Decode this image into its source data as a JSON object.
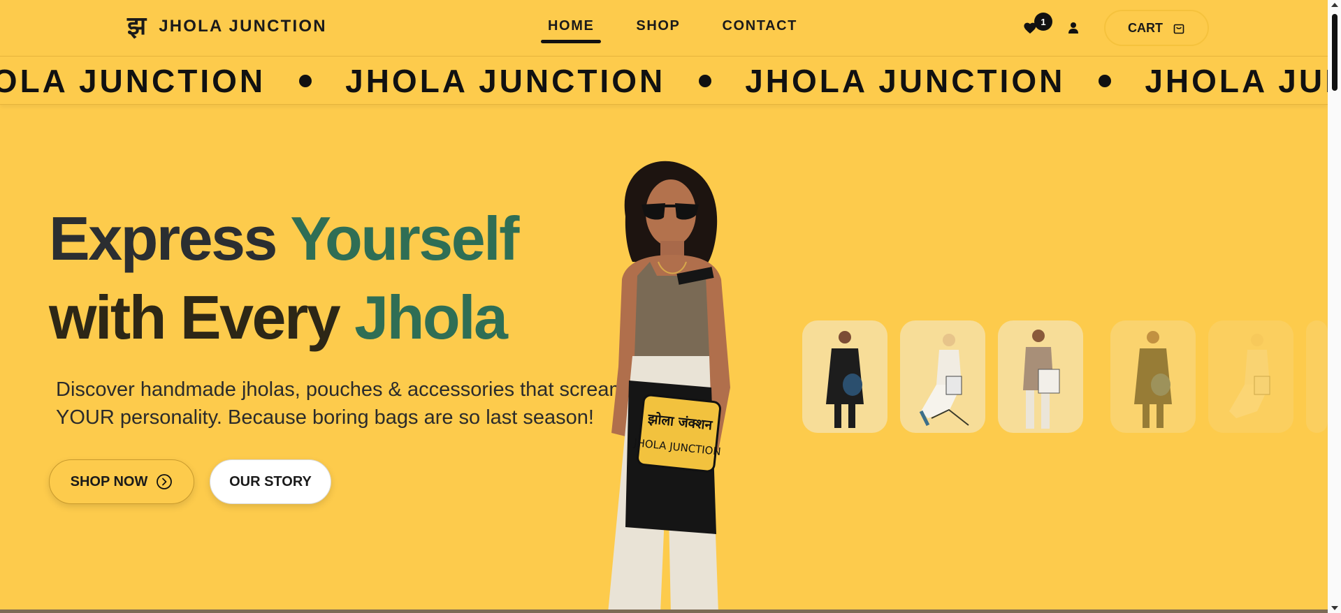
{
  "brand": {
    "logo_glyph": "झ",
    "name": "JHOLA JUNCTION"
  },
  "nav": {
    "home": "HOME",
    "shop": "SHOP",
    "contact": "CONTACT",
    "active": "HOME"
  },
  "header_actions": {
    "wishlist_icon": "heart-icon",
    "wishlist_count": "1",
    "account_icon": "user-icon",
    "cart_label": "CART",
    "cart_icon": "bag-icon"
  },
  "marquee": {
    "items": [
      "JHOLA JUNCTION",
      "JHOLA JUNCTION",
      "JHOLA JUNCTION",
      "JHOLA JUNCTION"
    ]
  },
  "hero": {
    "headline_line1_a": "Express",
    "headline_line1_b": "Yourself",
    "headline_line2_a": "with Every",
    "headline_line2_b": "Jhola",
    "subtitle": "Discover handmade jholas, pouches & accessories that scream YOUR personality. Because boring bags are so last season!",
    "cta_primary": "SHOP NOW",
    "cta_primary_icon": "arrow-right-circle-icon",
    "cta_secondary": "OUR STORY",
    "bag_print_line1": "झोला जंक्शन",
    "bag_print_line2": "JHOLA JUNCTION"
  },
  "thumbnails": [
    {
      "id": "model-man-black-coat"
    },
    {
      "id": "model-woman-seated"
    },
    {
      "id": "model-man-tote"
    },
    {
      "id": "model-man-black-coat"
    },
    {
      "id": "model-woman-seated"
    },
    {
      "id": "model-partial"
    }
  ],
  "colors": {
    "background": "#FDCB4C",
    "headline_dark": "#2b2e31",
    "headline_green": "#2f6e55",
    "headline_brown": "#2d2716"
  }
}
